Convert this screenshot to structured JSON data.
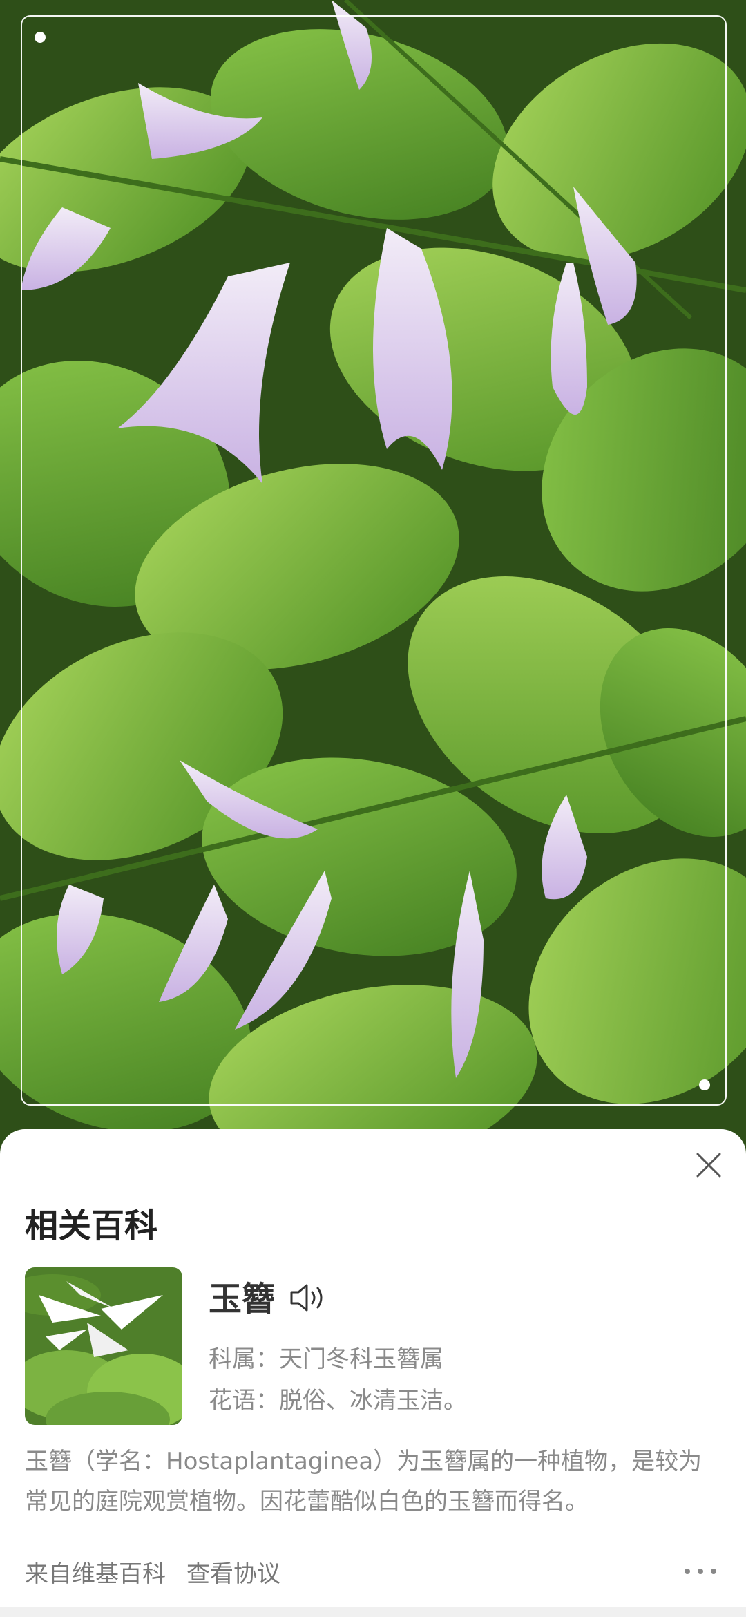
{
  "sheet": {
    "title": "相关百科",
    "close_icon": "close-icon"
  },
  "plant": {
    "name": "玉簪",
    "speaker_icon": "speaker-icon",
    "family": "科属：天门冬科玉簪属",
    "flower_language": "花语：脱俗、冰清玉洁。",
    "description": "玉簪（学名：Hostaplantaginea）为玉簪属的一种植物，是较为常见的庭院观赏植物。因花蕾酷似白色的玉簪而得名。"
  },
  "footer": {
    "source": "来自维基百科",
    "agreement": "查看协议",
    "more_icon": "more-icon"
  },
  "colors": {
    "leaf": "#7fbf3a",
    "flower": "#d9c8ea",
    "sheet_bg": "#ffffff",
    "text_secondary": "#8a8a8a"
  }
}
